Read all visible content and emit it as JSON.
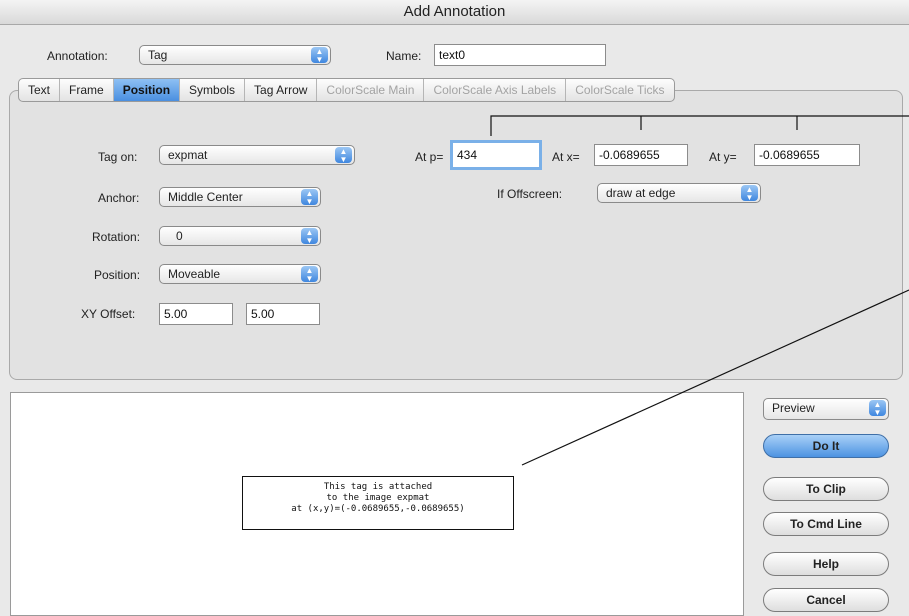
{
  "window": {
    "title": "Add Annotation"
  },
  "header": {
    "annotation_label": "Annotation:",
    "annotation_value": "Tag",
    "name_label": "Name:",
    "name_value": "text0"
  },
  "tabs": [
    {
      "label": "Text",
      "state": "normal"
    },
    {
      "label": "Frame",
      "state": "normal"
    },
    {
      "label": "Position",
      "state": "active"
    },
    {
      "label": "Symbols",
      "state": "normal"
    },
    {
      "label": "Tag Arrow",
      "state": "normal"
    },
    {
      "label": "ColorScale Main",
      "state": "disabled"
    },
    {
      "label": "ColorScale Axis Labels",
      "state": "disabled"
    },
    {
      "label": "ColorScale Ticks",
      "state": "disabled"
    }
  ],
  "position": {
    "tag_on_label": "Tag on:",
    "tag_on_value": "expmat",
    "anchor_label": "Anchor:",
    "anchor_value": "Middle Center",
    "rotation_label": "Rotation:",
    "rotation_value": "0",
    "position_label": "Position:",
    "position_value": "Moveable",
    "xy_offset_label": "XY Offset:",
    "xy_offset_x": "5.00",
    "xy_offset_y": "5.00",
    "at_p_label": "At p=",
    "at_p_value": "434",
    "at_x_label": "At x=",
    "at_x_value": "-0.0689655",
    "at_y_label": "At y=",
    "at_y_value": "-0.0689655",
    "offscreen_label": "If Offscreen:",
    "offscreen_value": "draw at edge"
  },
  "preview": {
    "lines": [
      "This tag is attached",
      "to the image expmat",
      "at (x,y)=(-0.0689655,-0.0689655)"
    ]
  },
  "buttons": {
    "preview_select": "Preview",
    "do_it": "Do It",
    "to_clip": "To Clip",
    "to_cmd_line": "To Cmd Line",
    "help": "Help",
    "cancel": "Cancel"
  },
  "colors": {
    "accent_blue": "#4a8fe0",
    "disabled_text": "#a3a3a3"
  }
}
